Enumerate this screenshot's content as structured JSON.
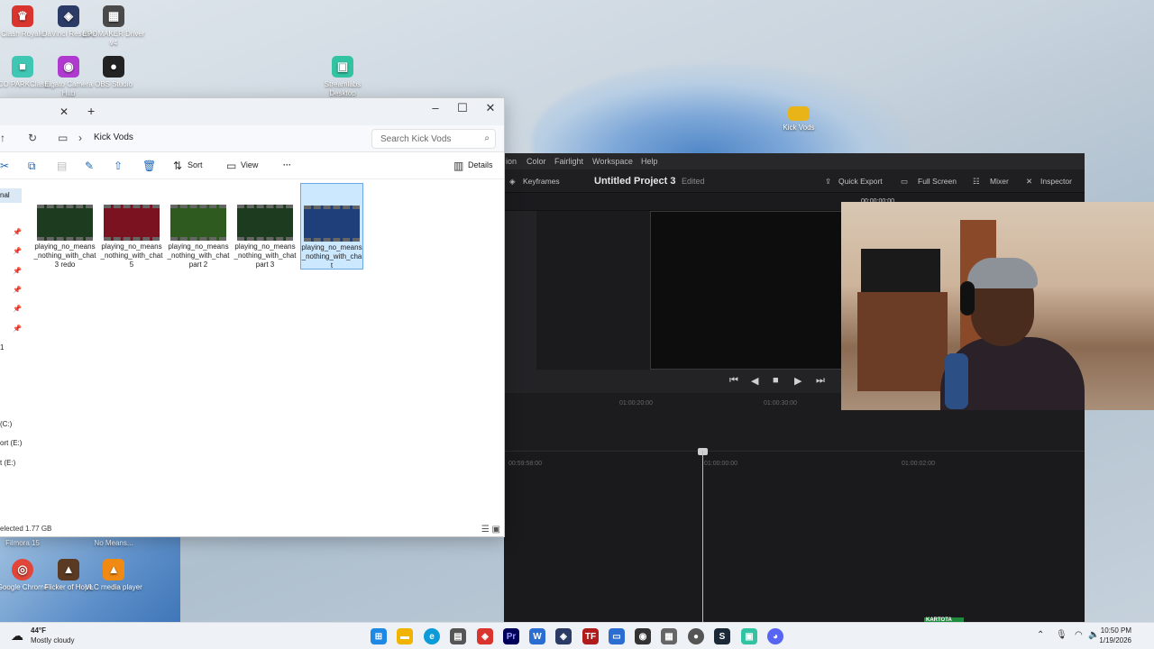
{
  "desktop": {
    "icons_top": [
      {
        "label": "Clash Royale",
        "color": "#d9352e",
        "glyph": "♛"
      },
      {
        "label": "DaVinci Resolve",
        "color": "#2b3b66",
        "glyph": "◈"
      },
      {
        "label": "EPOMAKER Driver v4",
        "color": "#4a4a4a",
        "glyph": "▦"
      },
      {
        "label": "PICO PARKClass...",
        "color": "#3fc7b4",
        "glyph": "■"
      },
      {
        "label": "Elgato Camera Hub",
        "color": "#b03ad0",
        "glyph": "◉"
      },
      {
        "label": "OBS Studio",
        "color": "#222222",
        "glyph": "●"
      },
      {
        "label": "Streamlabs Desktop",
        "color": "#32c3a2",
        "glyph": "▣"
      }
    ],
    "kick_vods_icon": {
      "label": "Kick Vods",
      "color": "#e8b418"
    },
    "icons_bottom_top_labels": [
      "Filmora 15",
      "No Means..."
    ],
    "icons_bottom": [
      {
        "label": "Google Chrome",
        "color": "#e14638",
        "glyph": "◎"
      },
      {
        "label": "Flicker of Hope",
        "color": "#5a3a22",
        "glyph": "▲"
      },
      {
        "label": "VLC media player",
        "color": "#f08a12",
        "glyph": "▲"
      }
    ]
  },
  "explorer": {
    "breadcrumb": "Kick Vods",
    "search_placeholder": "Search Kick Vods",
    "toolbar": {
      "sort": "Sort",
      "view": "View",
      "more": "···",
      "details": "Details"
    },
    "sidebar_selected": "nal",
    "sidebar_number": "1",
    "drives": [
      "(C:)",
      "ort (E:)",
      "t (E:)"
    ],
    "files": [
      {
        "name": "playing_no_means_nothing_with_chat 3 redo",
        "thumb": "#1d3b1e",
        "selected": false
      },
      {
        "name": "playing_no_means_nothing_with_chat 5",
        "thumb": "#7a1220",
        "selected": false
      },
      {
        "name": "playing_no_means_nothing_with_chat part 2",
        "thumb": "#2e5a1f",
        "selected": false
      },
      {
        "name": "playing_no_means_nothing_with_chat part 3",
        "thumb": "#1d3b1e",
        "selected": false
      },
      {
        "name": "playing_no_means_nothing_with_chat",
        "thumb": "#1e3f7a",
        "selected": true
      }
    ],
    "status": "elected  1.77 GB"
  },
  "resolve": {
    "menu": [
      "ion",
      "Color",
      "Fairlight",
      "Workspace",
      "Help"
    ],
    "keyframes": "Keyframes",
    "project_title": "Untitled Project 3",
    "edited": "Edited",
    "quick_export": "Quick Export",
    "full_screen": "Full Screen",
    "mixer": "Mixer",
    "inspector": "Inspector",
    "timecode": "00:00:00:00",
    "ruler_ticks": [
      "01:00:20:00",
      "01:00:30:00"
    ],
    "timeline_ticks": [
      "00:59:58:00",
      "01:00:00:00",
      "01:00:02:00"
    ]
  },
  "taskbar": {
    "temperature": "44°F",
    "weather": "Mostly cloudy",
    "time": "10:50 PM",
    "date": "1/19/2026",
    "overlay_label": "KARTOTA"
  }
}
